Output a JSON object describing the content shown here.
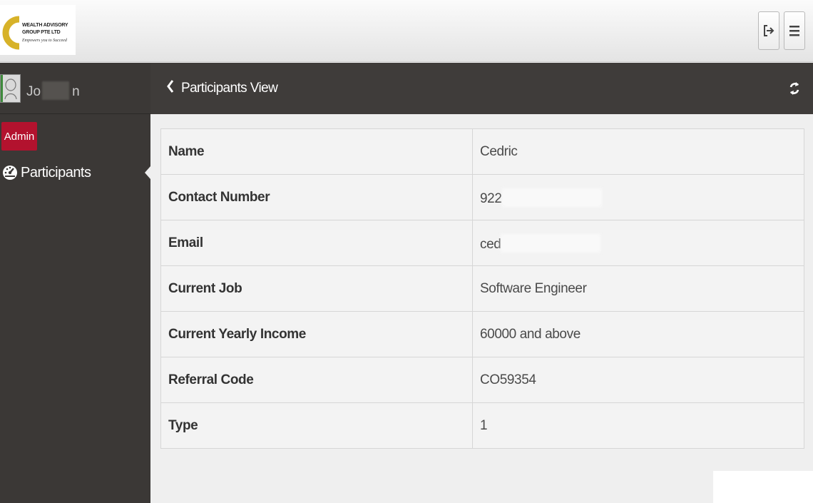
{
  "header": {
    "logo": {
      "line1": "WEALTH ADVISORY",
      "line2": "GROUP PTE LTD",
      "tagline": "Empowers you to Succeed"
    },
    "buttons": [
      "logout-icon",
      "menu-icon"
    ]
  },
  "sidebar": {
    "user": {
      "name_start": "Jo",
      "name_end": "n"
    },
    "role_badge": "Admin",
    "nav": [
      {
        "label": "Participants",
        "icon": "dashboard-icon"
      }
    ]
  },
  "page": {
    "title": "Participants View",
    "back_icon": "chevron-left-icon",
    "refresh_icon": "refresh-icon"
  },
  "details": [
    {
      "label": "Name",
      "value": "Cedric"
    },
    {
      "label": "Contact Number",
      "value": "922"
    },
    {
      "label": "Email",
      "value": "ced"
    },
    {
      "label": "Current Job",
      "value": "Software Engineer"
    },
    {
      "label": "Current Yearly Income",
      "value": "60000 and above"
    },
    {
      "label": "Referral Code",
      "value": "CO59354"
    },
    {
      "label": "Type",
      "value": "1"
    }
  ],
  "colors": {
    "sidebar_bg": "#3b3836",
    "bar_bg": "#3f3c3a",
    "badge": "#b3122e",
    "logo_ring": "#d7b229"
  }
}
